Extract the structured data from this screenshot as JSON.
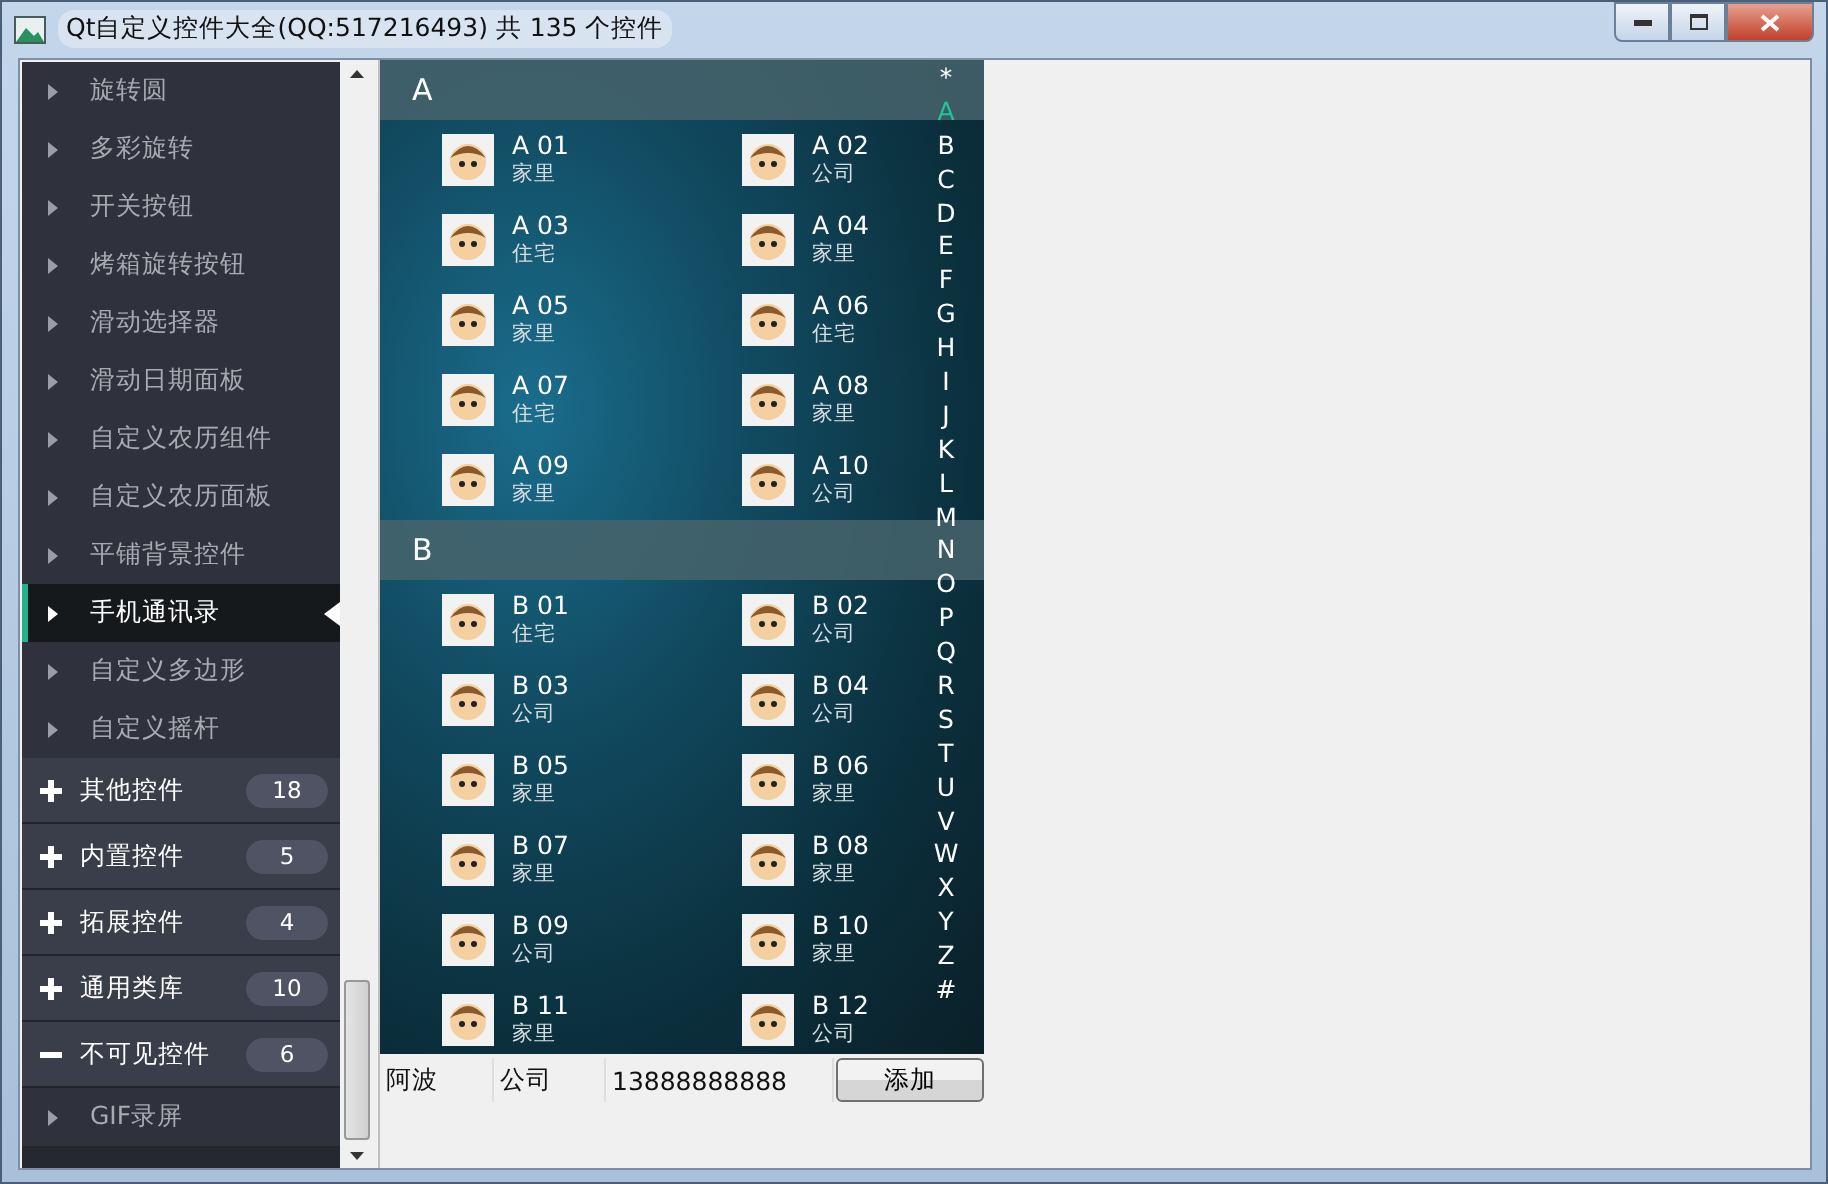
{
  "window": {
    "title": "Qt自定义控件大全(QQ:517216493) 共 135 个控件"
  },
  "sidebar": {
    "items": [
      {
        "kind": "child",
        "label": "旋转圆",
        "selected": false
      },
      {
        "kind": "child",
        "label": "多彩旋转",
        "selected": false
      },
      {
        "kind": "child",
        "label": "开关按钮",
        "selected": false
      },
      {
        "kind": "child",
        "label": "烤箱旋转按钮",
        "selected": false
      },
      {
        "kind": "child",
        "label": "滑动选择器",
        "selected": false
      },
      {
        "kind": "child",
        "label": "滑动日期面板",
        "selected": false
      },
      {
        "kind": "child",
        "label": "自定义农历组件",
        "selected": false
      },
      {
        "kind": "child",
        "label": "自定义农历面板",
        "selected": false
      },
      {
        "kind": "child",
        "label": "平铺背景控件",
        "selected": false
      },
      {
        "kind": "child",
        "label": "手机通讯录",
        "selected": true
      },
      {
        "kind": "child",
        "label": "自定义多边形",
        "selected": false
      },
      {
        "kind": "child",
        "label": "自定义摇杆",
        "selected": false
      },
      {
        "kind": "group",
        "label": "其他控件",
        "count": "18",
        "expanded": false
      },
      {
        "kind": "group",
        "label": "内置控件",
        "count": "5",
        "expanded": false
      },
      {
        "kind": "group",
        "label": "拓展控件",
        "count": "4",
        "expanded": false
      },
      {
        "kind": "group",
        "label": "通用类库",
        "count": "10",
        "expanded": false
      },
      {
        "kind": "group",
        "label": "不可见控件",
        "count": "6",
        "expanded": true,
        "children": [
          {
            "kind": "child",
            "label": "GIF录屏",
            "selected": false
          }
        ]
      }
    ]
  },
  "contacts": {
    "sections": [
      {
        "letter": "A",
        "entries": [
          {
            "name": "A 01",
            "place": "家里"
          },
          {
            "name": "A 02",
            "place": "公司"
          },
          {
            "name": "A 03",
            "place": "住宅"
          },
          {
            "name": "A 04",
            "place": "家里"
          },
          {
            "name": "A 05",
            "place": "家里"
          },
          {
            "name": "A 06",
            "place": "住宅"
          },
          {
            "name": "A 07",
            "place": "住宅"
          },
          {
            "name": "A 08",
            "place": "家里"
          },
          {
            "name": "A 09",
            "place": "家里"
          },
          {
            "name": "A 10",
            "place": "公司"
          }
        ]
      },
      {
        "letter": "B",
        "entries": [
          {
            "name": "B 01",
            "place": "住宅"
          },
          {
            "name": "B 02",
            "place": "公司"
          },
          {
            "name": "B 03",
            "place": "公司"
          },
          {
            "name": "B 04",
            "place": "公司"
          },
          {
            "name": "B 05",
            "place": "家里"
          },
          {
            "name": "B 06",
            "place": "家里"
          },
          {
            "name": "B 07",
            "place": "家里"
          },
          {
            "name": "B 08",
            "place": "家里"
          },
          {
            "name": "B 09",
            "place": "公司"
          },
          {
            "name": "B 10",
            "place": "家里"
          },
          {
            "name": "B 11",
            "place": "家里"
          },
          {
            "name": "B 12",
            "place": "公司"
          }
        ]
      }
    ],
    "index": [
      {
        "letter": "*",
        "selected": false
      },
      {
        "letter": "A",
        "selected": true
      },
      {
        "letter": "B",
        "selected": false
      },
      {
        "letter": "C",
        "selected": false
      },
      {
        "letter": "D",
        "selected": false
      },
      {
        "letter": "E",
        "selected": false
      },
      {
        "letter": "F",
        "selected": false
      },
      {
        "letter": "G",
        "selected": false
      },
      {
        "letter": "H",
        "selected": false
      },
      {
        "letter": "I",
        "selected": false
      },
      {
        "letter": "J",
        "selected": false
      },
      {
        "letter": "K",
        "selected": false
      },
      {
        "letter": "L",
        "selected": false
      },
      {
        "letter": "M",
        "selected": false
      },
      {
        "letter": "N",
        "selected": false
      },
      {
        "letter": "O",
        "selected": false
      },
      {
        "letter": "P",
        "selected": false
      },
      {
        "letter": "Q",
        "selected": false
      },
      {
        "letter": "R",
        "selected": false
      },
      {
        "letter": "S",
        "selected": false
      },
      {
        "letter": "T",
        "selected": false
      },
      {
        "letter": "U",
        "selected": false
      },
      {
        "letter": "V",
        "selected": false
      },
      {
        "letter": "W",
        "selected": false
      },
      {
        "letter": "X",
        "selected": false
      },
      {
        "letter": "Y",
        "selected": false
      },
      {
        "letter": "Z",
        "selected": false
      },
      {
        "letter": "#",
        "selected": false
      }
    ]
  },
  "form": {
    "name": "阿波",
    "place": "公司",
    "phone": "13888888888",
    "button": "添加"
  }
}
